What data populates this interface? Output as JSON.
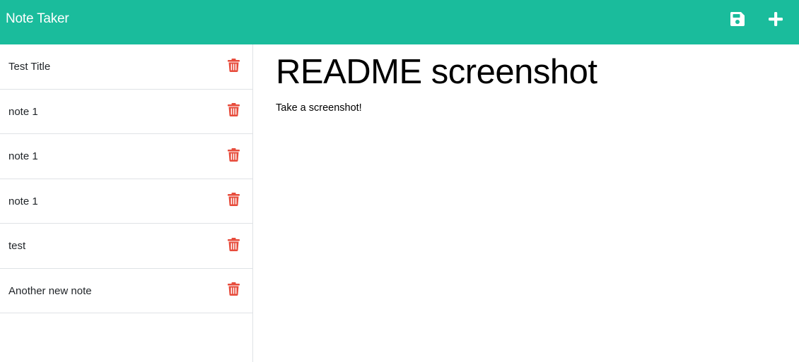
{
  "app": {
    "title": "Note Taker",
    "accent_color": "#1abc9c",
    "delete_color": "#e74c3c"
  },
  "toolbar": {
    "save_icon": "save-icon",
    "new_icon": "plus-icon"
  },
  "notes": [
    {
      "title": "Test Title"
    },
    {
      "title": "note 1"
    },
    {
      "title": "note 1"
    },
    {
      "title": "note 1"
    },
    {
      "title": "test"
    },
    {
      "title": "Another new note"
    }
  ],
  "active_note": {
    "title": "README screenshot",
    "text": "Take a screenshot!"
  }
}
